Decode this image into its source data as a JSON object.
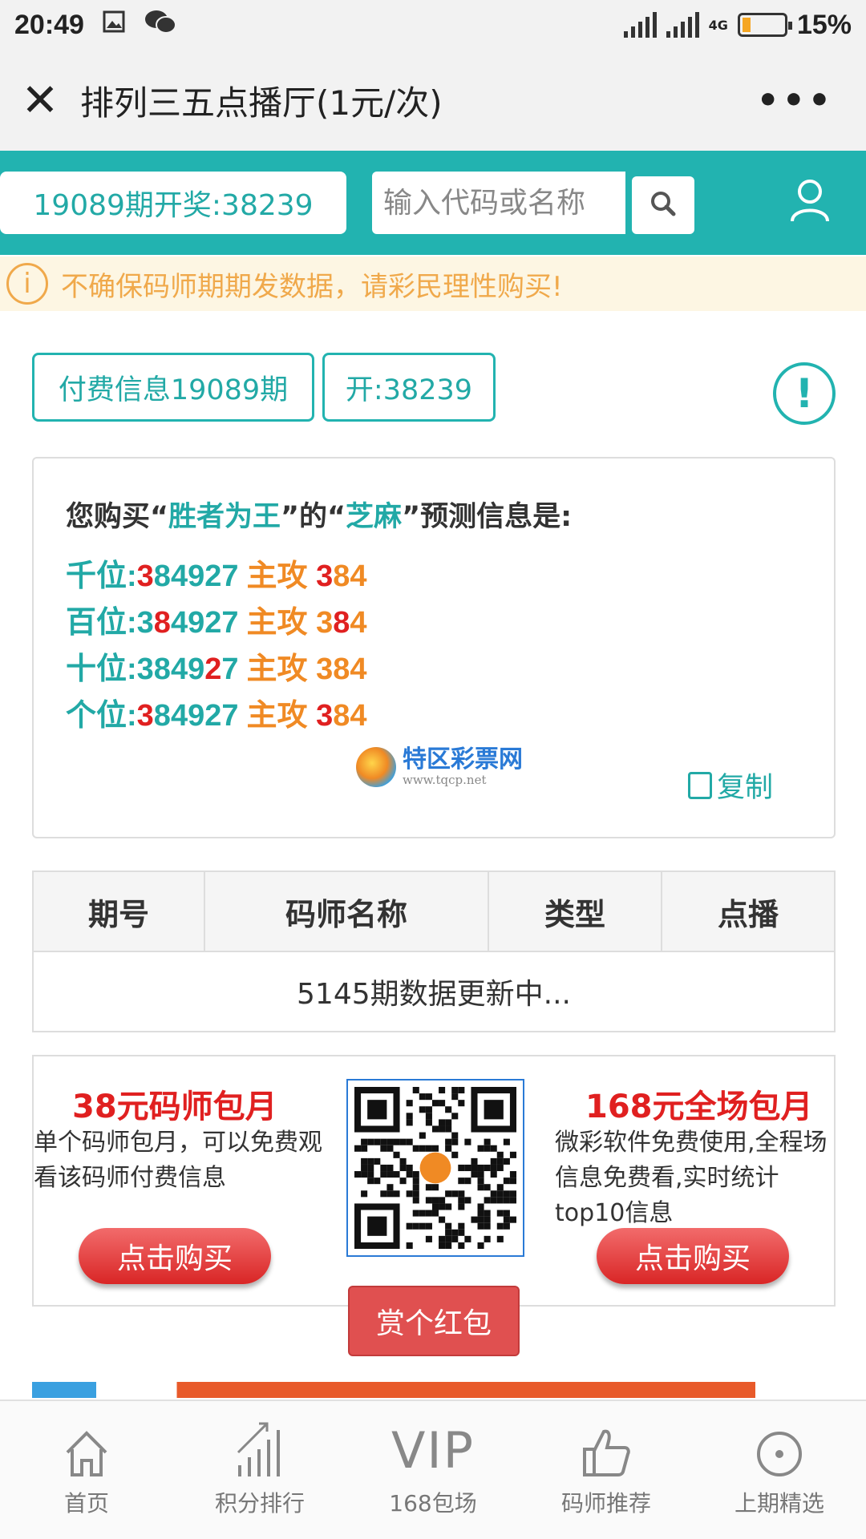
{
  "statusbar": {
    "time": "20:49",
    "battery": "15%",
    "network": "4G"
  },
  "titlebar": {
    "close": "✕",
    "title": "排列三五点播厅(1元/次)",
    "more": "•••"
  },
  "header": {
    "draw_result": "19089期开奖:38239",
    "search_placeholder": "输入代码或名称"
  },
  "notice": {
    "icon": "i",
    "text": "不确保码师期期发数据，请彩民理性购买!"
  },
  "period": {
    "paid_info": "付费信息19089期",
    "open": "开:38239",
    "alert": "!"
  },
  "prediction": {
    "prefix": "您购买“",
    "master": "胜者为王",
    "mid": "”的“",
    "type": "芝麻",
    "suffix": "”预测信息是:",
    "rows": [
      {
        "pos": "千位:",
        "num": [
          [
            "3",
            true
          ],
          [
            "8",
            false
          ],
          [
            "4",
            false
          ],
          [
            "9",
            false
          ],
          [
            "2",
            false
          ],
          [
            "7",
            false
          ]
        ],
        "label": "主攻",
        "attack": [
          [
            "3",
            true
          ],
          [
            "8",
            false
          ],
          [
            "4",
            false
          ]
        ]
      },
      {
        "pos": "百位:",
        "num": [
          [
            "3",
            false
          ],
          [
            "8",
            true
          ],
          [
            "4",
            false
          ],
          [
            "9",
            false
          ],
          [
            "2",
            false
          ],
          [
            "7",
            false
          ]
        ],
        "label": "主攻",
        "attack": [
          [
            "3",
            false
          ],
          [
            "8",
            true
          ],
          [
            "4",
            false
          ]
        ]
      },
      {
        "pos": "十位:",
        "num": [
          [
            "3",
            false
          ],
          [
            "8",
            false
          ],
          [
            "4",
            false
          ],
          [
            "9",
            false
          ],
          [
            "2",
            true
          ],
          [
            "7",
            false
          ]
        ],
        "label": "主攻",
        "attack": [
          [
            "3",
            false
          ],
          [
            "8",
            false
          ],
          [
            "4",
            false
          ]
        ]
      },
      {
        "pos": "个位:",
        "num": [
          [
            "3",
            true
          ],
          [
            "8",
            false
          ],
          [
            "4",
            false
          ],
          [
            "9",
            false
          ],
          [
            "2",
            false
          ],
          [
            "7",
            false
          ]
        ],
        "label": "主攻",
        "attack": [
          [
            "3",
            true
          ],
          [
            "8",
            false
          ],
          [
            "4",
            false
          ]
        ]
      }
    ],
    "logo_name": "特区彩票网",
    "logo_url": "www.tqcp.net",
    "copy": "复制"
  },
  "table": {
    "headers": [
      "期号",
      "码师名称",
      "类型",
      "点播"
    ],
    "empty_row": "5145期数据更新中..."
  },
  "packages": {
    "left": {
      "title": "38元码师包月",
      "desc": "单个码师包月，可以免费观看该码师付费信息",
      "button": "点击购买"
    },
    "right": {
      "title": "168元全场包月",
      "desc": "微彩软件免费使用,全程场信息免费看,实时统计top10信息",
      "button": "点击购买"
    },
    "reward": "赏个红包"
  },
  "colors": {
    "teal": "#22b3b0",
    "red": "#e02020",
    "orange": "#f08a24",
    "notice": "#f0a94b"
  },
  "bottom_nav": [
    {
      "icon": "home-icon",
      "label": "首页"
    },
    {
      "icon": "ranking-icon",
      "label": "积分排行"
    },
    {
      "icon": "vip-icon",
      "icon_text": "VIP",
      "label": "168包场"
    },
    {
      "icon": "thumbs-up-icon",
      "label": "码师推荐"
    },
    {
      "icon": "target-icon",
      "label": "上期精选"
    }
  ]
}
